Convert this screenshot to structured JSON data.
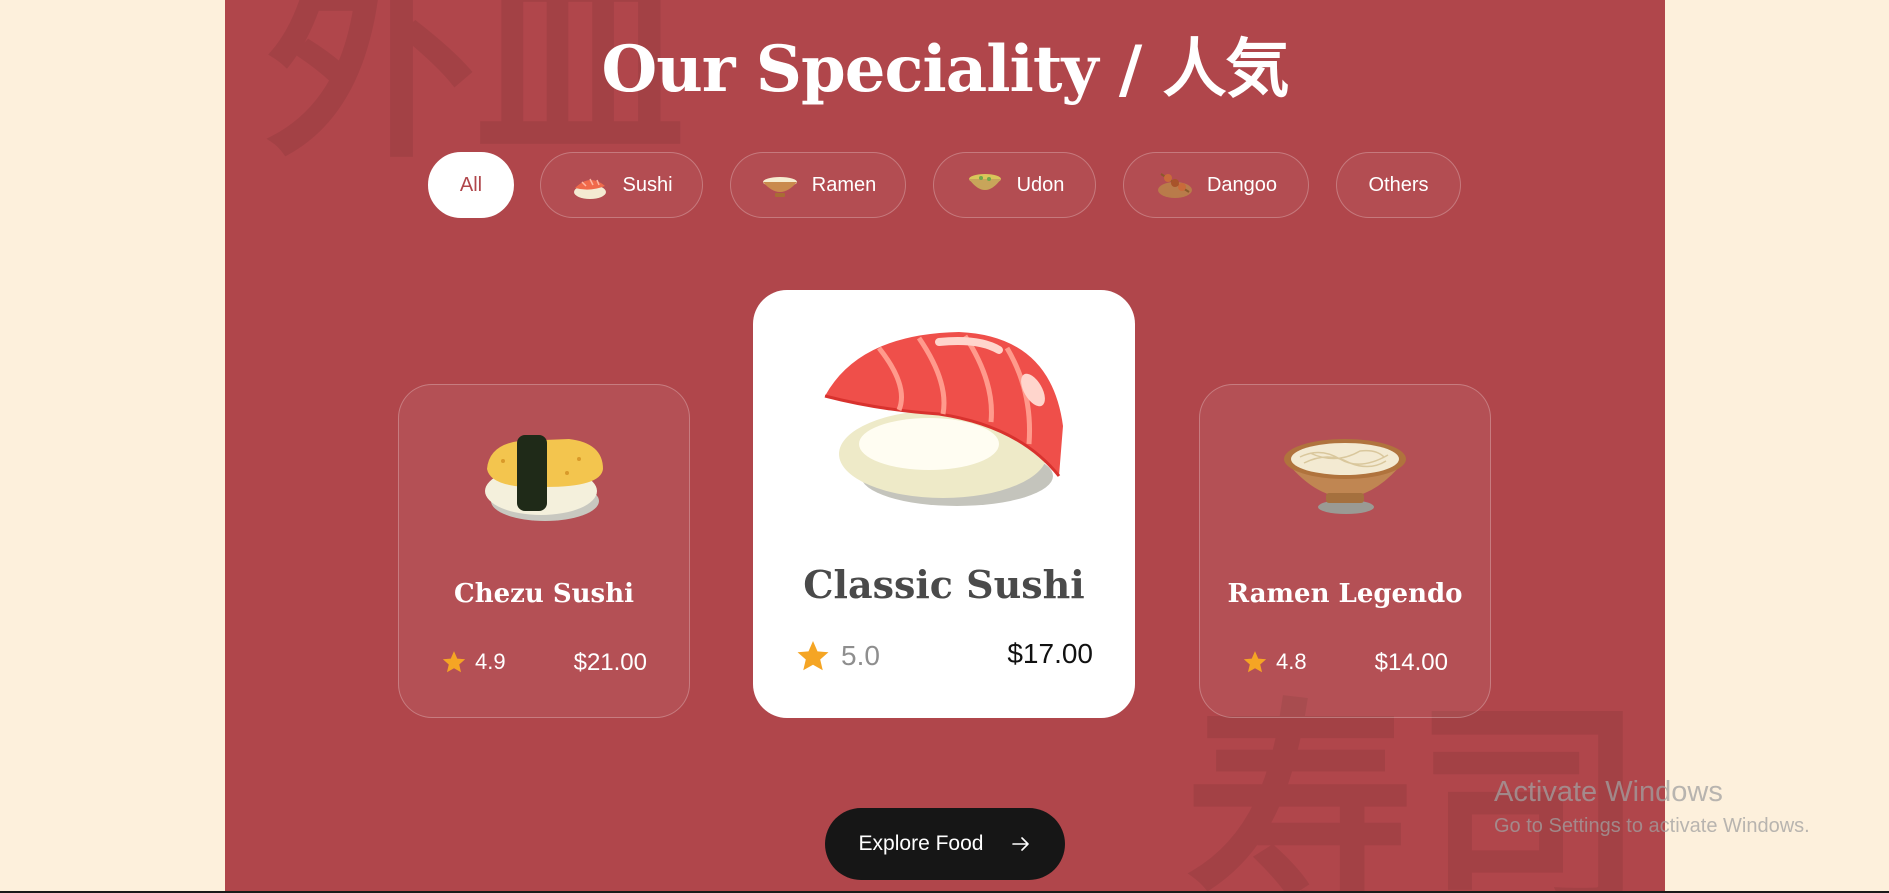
{
  "section": {
    "title": "Our Speciality / 人気",
    "decor_glyph_top": "外皿",
    "decor_glyph_bottom": "寿司"
  },
  "filters": [
    {
      "label": "All",
      "active": true,
      "icon": null
    },
    {
      "label": "Sushi",
      "active": false,
      "icon": "sushi-icon"
    },
    {
      "label": "Ramen",
      "active": false,
      "icon": "ramen-bowl-icon"
    },
    {
      "label": "Udon",
      "active": false,
      "icon": "udon-bowl-icon"
    },
    {
      "label": "Dangoo",
      "active": false,
      "icon": "dango-skewer-icon"
    },
    {
      "label": "Others",
      "active": false,
      "icon": null
    }
  ],
  "cards": [
    {
      "name": "Chezu Sushi",
      "rating": "4.9",
      "price": "$21.00",
      "image": "tamago-sushi-icon",
      "featured": false
    },
    {
      "name": "Classic Sushi",
      "rating": "5.0",
      "price": "$17.00",
      "image": "salmon-nigiri-icon",
      "featured": true
    },
    {
      "name": "Ramen Legendo",
      "rating": "4.8",
      "price": "$14.00",
      "image": "ramen-bowl-icon",
      "featured": false
    }
  ],
  "cta": {
    "label": "Explore Food",
    "icon": "arrow-right-icon"
  },
  "watermark": {
    "line1": "Activate Windows",
    "line2": "Go to Settings to activate Windows."
  },
  "colors": {
    "page_bg": "#fdf0dc",
    "panel_bg": "#b0464b",
    "star": "#f5a524",
    "button_bg": "#161616",
    "active_chip_text": "#b0464b"
  }
}
